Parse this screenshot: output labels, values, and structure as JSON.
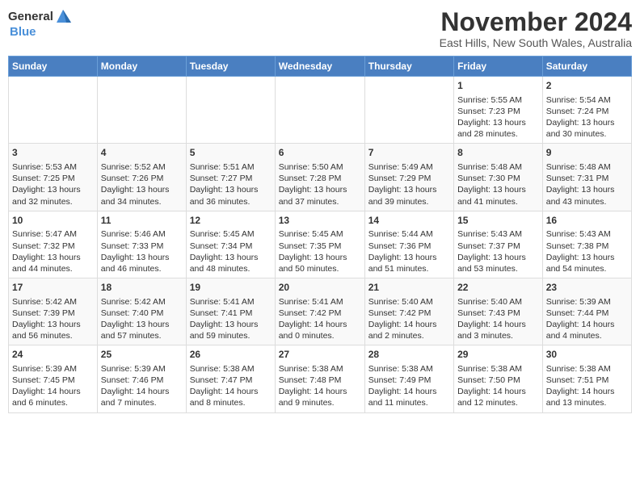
{
  "logo": {
    "general": "General",
    "blue": "Blue"
  },
  "title": "November 2024",
  "subtitle": "East Hills, New South Wales, Australia",
  "weekdays": [
    "Sunday",
    "Monday",
    "Tuesday",
    "Wednesday",
    "Thursday",
    "Friday",
    "Saturday"
  ],
  "weeks": [
    [
      {
        "day": "",
        "info": ""
      },
      {
        "day": "",
        "info": ""
      },
      {
        "day": "",
        "info": ""
      },
      {
        "day": "",
        "info": ""
      },
      {
        "day": "",
        "info": ""
      },
      {
        "day": "1",
        "info": "Sunrise: 5:55 AM\nSunset: 7:23 PM\nDaylight: 13 hours\nand 28 minutes."
      },
      {
        "day": "2",
        "info": "Sunrise: 5:54 AM\nSunset: 7:24 PM\nDaylight: 13 hours\nand 30 minutes."
      }
    ],
    [
      {
        "day": "3",
        "info": "Sunrise: 5:53 AM\nSunset: 7:25 PM\nDaylight: 13 hours\nand 32 minutes."
      },
      {
        "day": "4",
        "info": "Sunrise: 5:52 AM\nSunset: 7:26 PM\nDaylight: 13 hours\nand 34 minutes."
      },
      {
        "day": "5",
        "info": "Sunrise: 5:51 AM\nSunset: 7:27 PM\nDaylight: 13 hours\nand 36 minutes."
      },
      {
        "day": "6",
        "info": "Sunrise: 5:50 AM\nSunset: 7:28 PM\nDaylight: 13 hours\nand 37 minutes."
      },
      {
        "day": "7",
        "info": "Sunrise: 5:49 AM\nSunset: 7:29 PM\nDaylight: 13 hours\nand 39 minutes."
      },
      {
        "day": "8",
        "info": "Sunrise: 5:48 AM\nSunset: 7:30 PM\nDaylight: 13 hours\nand 41 minutes."
      },
      {
        "day": "9",
        "info": "Sunrise: 5:48 AM\nSunset: 7:31 PM\nDaylight: 13 hours\nand 43 minutes."
      }
    ],
    [
      {
        "day": "10",
        "info": "Sunrise: 5:47 AM\nSunset: 7:32 PM\nDaylight: 13 hours\nand 44 minutes."
      },
      {
        "day": "11",
        "info": "Sunrise: 5:46 AM\nSunset: 7:33 PM\nDaylight: 13 hours\nand 46 minutes."
      },
      {
        "day": "12",
        "info": "Sunrise: 5:45 AM\nSunset: 7:34 PM\nDaylight: 13 hours\nand 48 minutes."
      },
      {
        "day": "13",
        "info": "Sunrise: 5:45 AM\nSunset: 7:35 PM\nDaylight: 13 hours\nand 50 minutes."
      },
      {
        "day": "14",
        "info": "Sunrise: 5:44 AM\nSunset: 7:36 PM\nDaylight: 13 hours\nand 51 minutes."
      },
      {
        "day": "15",
        "info": "Sunrise: 5:43 AM\nSunset: 7:37 PM\nDaylight: 13 hours\nand 53 minutes."
      },
      {
        "day": "16",
        "info": "Sunrise: 5:43 AM\nSunset: 7:38 PM\nDaylight: 13 hours\nand 54 minutes."
      }
    ],
    [
      {
        "day": "17",
        "info": "Sunrise: 5:42 AM\nSunset: 7:39 PM\nDaylight: 13 hours\nand 56 minutes."
      },
      {
        "day": "18",
        "info": "Sunrise: 5:42 AM\nSunset: 7:40 PM\nDaylight: 13 hours\nand 57 minutes."
      },
      {
        "day": "19",
        "info": "Sunrise: 5:41 AM\nSunset: 7:41 PM\nDaylight: 13 hours\nand 59 minutes."
      },
      {
        "day": "20",
        "info": "Sunrise: 5:41 AM\nSunset: 7:42 PM\nDaylight: 14 hours\nand 0 minutes."
      },
      {
        "day": "21",
        "info": "Sunrise: 5:40 AM\nSunset: 7:42 PM\nDaylight: 14 hours\nand 2 minutes."
      },
      {
        "day": "22",
        "info": "Sunrise: 5:40 AM\nSunset: 7:43 PM\nDaylight: 14 hours\nand 3 minutes."
      },
      {
        "day": "23",
        "info": "Sunrise: 5:39 AM\nSunset: 7:44 PM\nDaylight: 14 hours\nand 4 minutes."
      }
    ],
    [
      {
        "day": "24",
        "info": "Sunrise: 5:39 AM\nSunset: 7:45 PM\nDaylight: 14 hours\nand 6 minutes."
      },
      {
        "day": "25",
        "info": "Sunrise: 5:39 AM\nSunset: 7:46 PM\nDaylight: 14 hours\nand 7 minutes."
      },
      {
        "day": "26",
        "info": "Sunrise: 5:38 AM\nSunset: 7:47 PM\nDaylight: 14 hours\nand 8 minutes."
      },
      {
        "day": "27",
        "info": "Sunrise: 5:38 AM\nSunset: 7:48 PM\nDaylight: 14 hours\nand 9 minutes."
      },
      {
        "day": "28",
        "info": "Sunrise: 5:38 AM\nSunset: 7:49 PM\nDaylight: 14 hours\nand 11 minutes."
      },
      {
        "day": "29",
        "info": "Sunrise: 5:38 AM\nSunset: 7:50 PM\nDaylight: 14 hours\nand 12 minutes."
      },
      {
        "day": "30",
        "info": "Sunrise: 5:38 AM\nSunset: 7:51 PM\nDaylight: 14 hours\nand 13 minutes."
      }
    ]
  ]
}
